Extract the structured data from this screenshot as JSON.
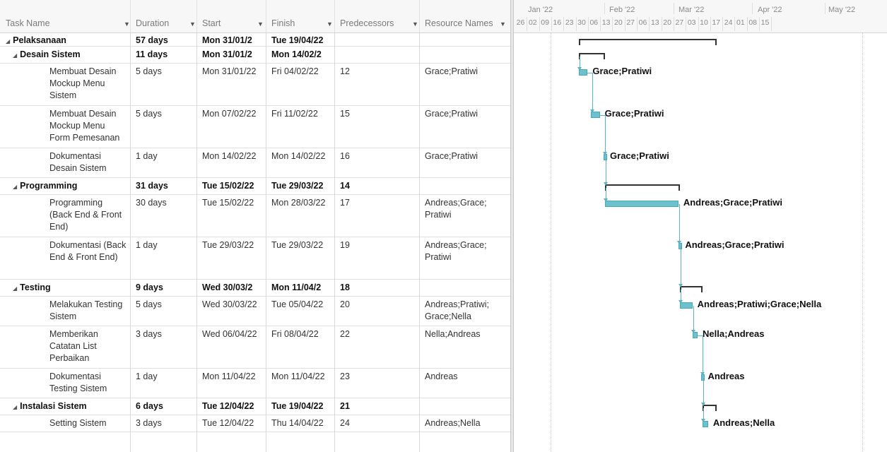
{
  "columns": {
    "task_name": "Task Name",
    "duration": "Duration",
    "start": "Start",
    "finish": "Finish",
    "predecessors": "Predecessors",
    "resource_names": "Resource Names"
  },
  "timescale": {
    "months": [
      "Jan '22",
      "Feb '22",
      "Mar '22",
      "Apr '22",
      "May '22"
    ],
    "weeks": [
      "26",
      "02",
      "09",
      "16",
      "23",
      "30",
      "06",
      "13",
      "20",
      "27",
      "06",
      "13",
      "20",
      "27",
      "03",
      "10",
      "17",
      "24",
      "01",
      "08",
      "15"
    ]
  },
  "tasks": [
    {
      "name": "Pelaksanaan",
      "duration": "57 days",
      "start": "Mon 31/01/2",
      "finish": "Tue 19/04/22",
      "pred": "",
      "res": "",
      "summary": true,
      "level": 0
    },
    {
      "name": "Desain Sistem",
      "duration": "11 days",
      "start": "Mon 31/01/2",
      "finish": "Mon 14/02/2",
      "pred": "",
      "res": "",
      "summary": true,
      "level": 1
    },
    {
      "name": "Membuat Desain Mockup Menu Sistem",
      "duration": "5 days",
      "start": "Mon 31/01/22",
      "finish": "Fri 04/02/22",
      "pred": "12",
      "res": "Grace;Pratiwi",
      "summary": false,
      "level": 2
    },
    {
      "name": "Membuat Desain Mockup Menu Form Pemesanan",
      "duration": "5 days",
      "start": "Mon 07/02/22",
      "finish": "Fri 11/02/22",
      "pred": "15",
      "res": "Grace;Pratiwi",
      "summary": false,
      "level": 2
    },
    {
      "name": "Dokumentasi Desain Sistem",
      "duration": "1 day",
      "start": "Mon 14/02/22",
      "finish": "Mon 14/02/22",
      "pred": "16",
      "res": "Grace;Pratiwi",
      "summary": false,
      "level": 2
    },
    {
      "name": "Programming",
      "duration": "31 days",
      "start": "Tue 15/02/22",
      "finish": "Tue 29/03/22",
      "pred": "14",
      "res": "",
      "summary": true,
      "level": 1
    },
    {
      "name": "Programming (Back End & Front End)",
      "duration": "30 days",
      "start": "Tue 15/02/22",
      "finish": "Mon 28/03/22",
      "pred": "17",
      "res": "Andreas;Grace; Pratiwi",
      "summary": false,
      "level": 2
    },
    {
      "name": "Dokumentasi (Back End & Front End)",
      "duration": "1 day",
      "start": "Tue 29/03/22",
      "finish": "Tue 29/03/22",
      "pred": "19",
      "res": "Andreas;Grace; Pratiwi",
      "summary": false,
      "level": 2
    },
    {
      "name": "Testing",
      "duration": "9 days",
      "start": "Wed 30/03/2",
      "finish": "Mon 11/04/2",
      "pred": "18",
      "res": "",
      "summary": true,
      "level": 1
    },
    {
      "name": "Melakukan Testing Sistem",
      "duration": "5 days",
      "start": "Wed 30/03/22",
      "finish": "Tue 05/04/22",
      "pred": "20",
      "res": "Andreas;Pratiwi; Grace;Nella",
      "summary": false,
      "level": 2
    },
    {
      "name": "Memberikan Catatan List Perbaikan",
      "duration": "3 days",
      "start": "Wed 06/04/22",
      "finish": "Fri 08/04/22",
      "pred": "22",
      "res": "Nella;Andreas",
      "summary": false,
      "level": 2
    },
    {
      "name": "Dokumentasi Testing Sistem",
      "duration": "1 day",
      "start": "Mon 11/04/22",
      "finish": "Mon 11/04/22",
      "pred": "23",
      "res": "Andreas",
      "summary": false,
      "level": 2
    },
    {
      "name": "Instalasi Sistem",
      "duration": "6 days",
      "start": "Tue 12/04/22",
      "finish": "Tue 19/04/22",
      "pred": "21",
      "res": "",
      "summary": true,
      "level": 1
    },
    {
      "name": "Setting Sistem",
      "duration": "3 days",
      "start": "Tue 12/04/22",
      "finish": "Thu 14/04/22",
      "pred": "24",
      "res": "Andreas;Nella",
      "summary": false,
      "level": 2
    }
  ],
  "bar_labels": [
    "Grace;Pratiwi",
    "Grace;Pratiwi",
    "Grace;Pratiwi",
    "Andreas;Grace;Pratiwi",
    "Andreas;Grace;Pratiwi",
    "Andreas;Pratiwi;Grace;Nella",
    "Nella;Andreas",
    "Andreas",
    "Andreas;Nella"
  ],
  "colors": {
    "task_bar": "#6cc2cc",
    "summary_bar": "#333333",
    "link": "#5ab3c9"
  }
}
